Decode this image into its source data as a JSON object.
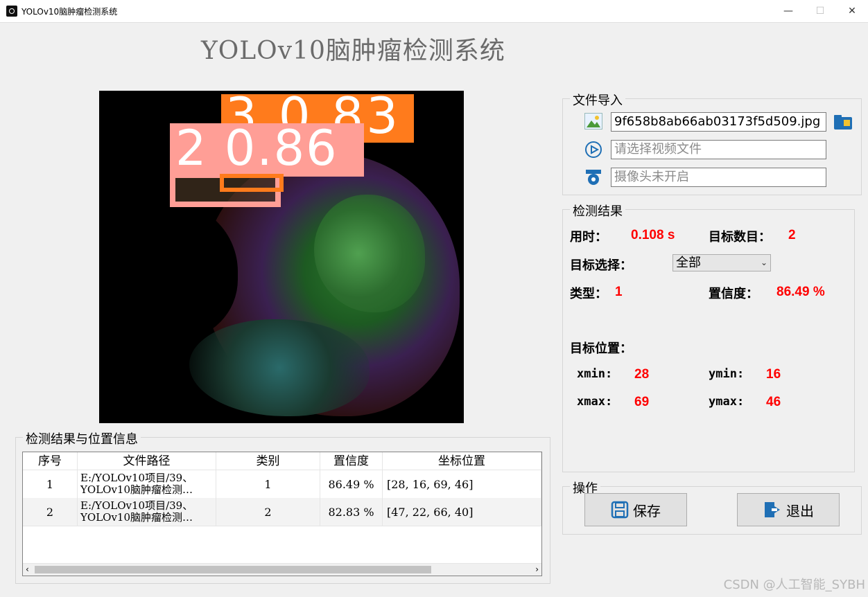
{
  "window": {
    "title": "YOLOv10脑肿瘤检测系统",
    "minimize": "—",
    "maximize": "☐",
    "close": "✕"
  },
  "main_title": "YOLOv10脑肿瘤检测系统",
  "image": {
    "detections": [
      {
        "label": "3  0.83",
        "color": "#ff7b1c"
      },
      {
        "label": "2  0.86",
        "color": "#ff9e96"
      }
    ]
  },
  "file_import": {
    "title": "文件导入",
    "image_path": "9f658b8ab66ab03173f5d509.jpg",
    "video_placeholder": "请选择视频文件",
    "camera_placeholder": "摄像头未开启"
  },
  "results": {
    "title": "检测结果",
    "time_label": "用时：",
    "time_value": "0.108 s",
    "count_label": "目标数目：",
    "count_value": "2",
    "select_label": "目标选择：",
    "select_value": "全部",
    "type_label": "类型：",
    "type_value": "1",
    "conf_label": "置信度：",
    "conf_value": "86.49 %",
    "pos_label": "目标位置：",
    "xmin_label": "xmin:",
    "xmin_value": "28",
    "ymin_label": "ymin:",
    "ymin_value": "16",
    "xmax_label": "xmax:",
    "xmax_value": "69",
    "ymax_label": "ymax:",
    "ymax_value": "46"
  },
  "operations": {
    "title": "操作",
    "save_label": "保存",
    "exit_label": "退出"
  },
  "table": {
    "title": "检测结果与位置信息",
    "headers": [
      "序号",
      "文件路径",
      "类别",
      "置信度",
      "坐标位置"
    ],
    "rows": [
      {
        "index": "1",
        "path1": "E:/YOLOv10项目/39、",
        "path2": "YOLOv10脑肿瘤检测…",
        "class": "1",
        "conf": "86.49 %",
        "coords": "[28, 16, 69, 46]"
      },
      {
        "index": "2",
        "path1": "E:/YOLOv10项目/39、",
        "path2": "YOLOv10脑肿瘤检测…",
        "class": "2",
        "conf": "82.83 %",
        "coords": "[47, 22, 66, 40]"
      }
    ]
  },
  "watermark": "CSDN @人工智能_SYBH"
}
